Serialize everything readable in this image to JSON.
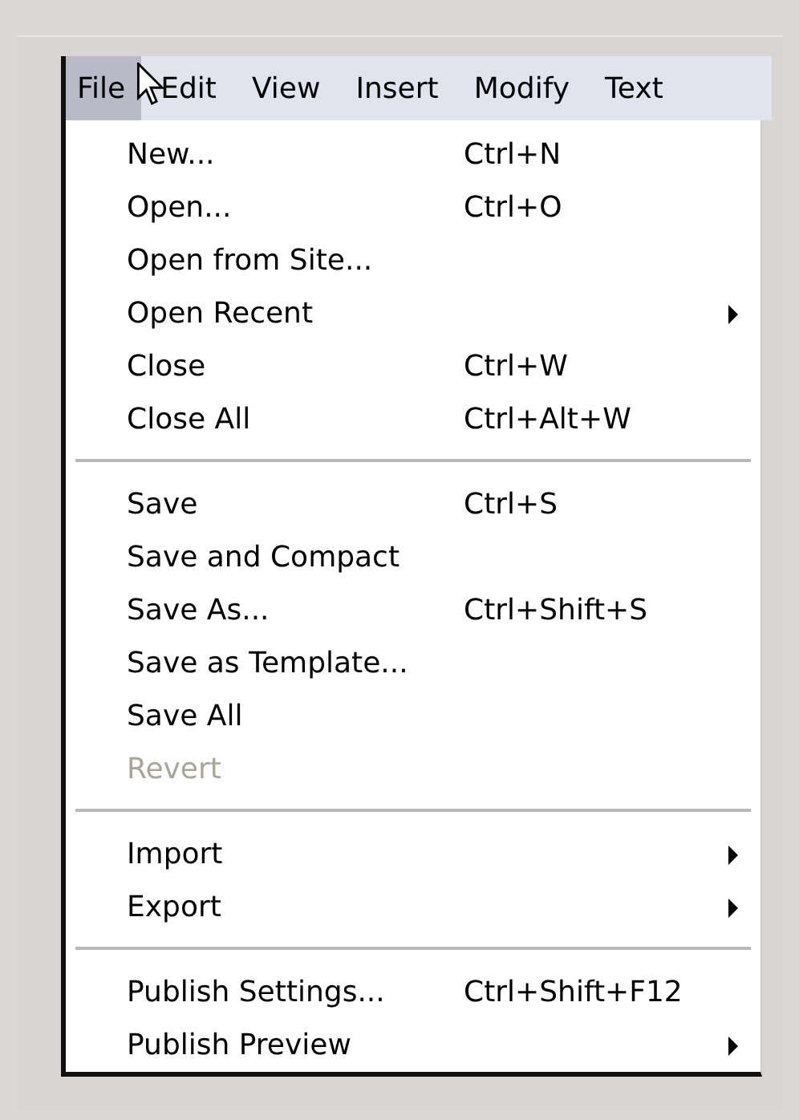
{
  "menu_bar": [
    {
      "label": "File",
      "selected": true
    },
    {
      "label": "Edit",
      "selected": false
    },
    {
      "label": "View",
      "selected": false
    },
    {
      "label": "Insert",
      "selected": false
    },
    {
      "label": "Modify",
      "selected": false
    },
    {
      "label": "Text",
      "selected": false
    }
  ],
  "file_menu": [
    [
      {
        "label": "New...",
        "shortcut": "Ctrl+N",
        "submenu": false,
        "disabled": false
      },
      {
        "label": "Open...",
        "shortcut": "Ctrl+O",
        "submenu": false,
        "disabled": false
      },
      {
        "label": "Open from Site...",
        "submenu": false,
        "disabled": false
      },
      {
        "label": "Open Recent",
        "submenu": true,
        "disabled": false
      },
      {
        "label": "Close",
        "shortcut": "Ctrl+W",
        "submenu": false,
        "disabled": false
      },
      {
        "label": "Close All",
        "shortcut": "Ctrl+Alt+W",
        "submenu": false,
        "disabled": false
      }
    ],
    [
      {
        "label": "Save",
        "shortcut": "Ctrl+S",
        "submenu": false,
        "disabled": false
      },
      {
        "label": "Save and Compact",
        "submenu": false,
        "disabled": false
      },
      {
        "label": "Save As...",
        "shortcut": "Ctrl+Shift+S",
        "submenu": false,
        "disabled": false
      },
      {
        "label": "Save as Template...",
        "submenu": false,
        "disabled": false
      },
      {
        "label": "Save All",
        "submenu": false,
        "disabled": false
      },
      {
        "label": "Revert",
        "submenu": false,
        "disabled": true
      }
    ],
    [
      {
        "label": "Import",
        "submenu": true,
        "disabled": false
      },
      {
        "label": "Export",
        "submenu": true,
        "disabled": false
      }
    ],
    [
      {
        "label": "Publish Settings...",
        "shortcut": "Ctrl+Shift+F12",
        "submenu": false,
        "disabled": false
      },
      {
        "label": "Publish Preview",
        "submenu": true,
        "disabled": false
      }
    ]
  ]
}
